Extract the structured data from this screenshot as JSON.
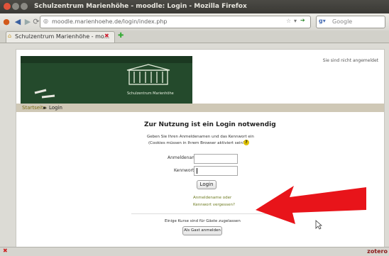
{
  "window": {
    "title": "Schulzentrum Marienhöhe - moodle: Login - Mozilla Firefox"
  },
  "navbar": {
    "url": "moodle.marienhoehe.de/login/index.php",
    "search_placeholder": "Google"
  },
  "tabs": [
    {
      "label": "Schulzentrum Marienhöhe - mo..."
    }
  ],
  "page": {
    "login_status": "Sie sind nicht angemeldet",
    "banner_caption": "Schulzentrum Marienhöhe",
    "breadcrumb": {
      "home": "Startseite",
      "sep": "►",
      "current": "Login"
    },
    "heading": "Zur Nutzung ist ein Login notwendig",
    "intro_line1": "Geben Sie Ihren Anmeldenamen und das Kennwort ein",
    "intro_line2": "(Cookies müssen in Ihrem Browser aktiviert sein!)",
    "form": {
      "username_label": "Anmeldename",
      "password_label": "Kennwort",
      "username_value": "",
      "password_value": "",
      "login_button": "Login",
      "forgot_line1": "Anmeldename oder",
      "forgot_line2": "Kennwort vergessen?"
    },
    "guest_text": "Einige Kurse sind für Gäste zugelassen",
    "guest_button": "Als Gast anmelden"
  },
  "statusbar": {
    "zotero": "zotero"
  },
  "colors": {
    "accent_link": "#6e7b21",
    "arrow": "#e8141a",
    "banner": "#2f5e38"
  }
}
